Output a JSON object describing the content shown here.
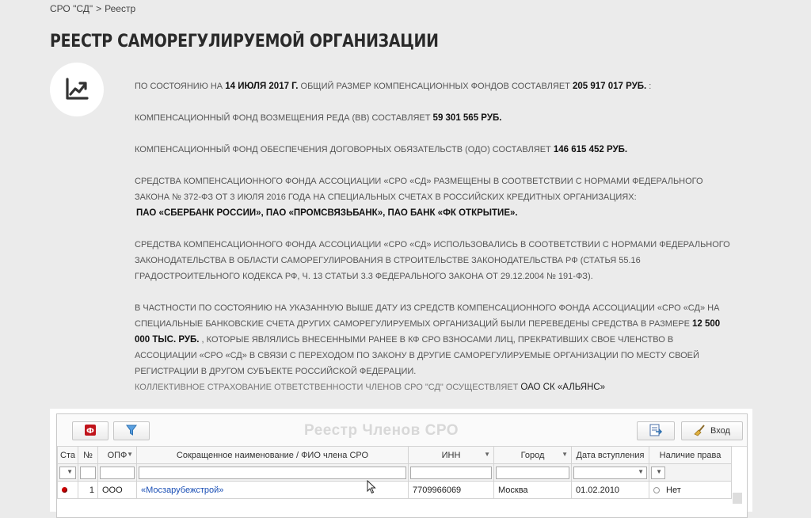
{
  "breadcrumb": {
    "home": "СРО \"СД\"",
    "separator": ">",
    "current": "Реестр"
  },
  "page_title": "РЕЕСТР САМОРЕГУЛИРУЕМОЙ ОРГАНИЗАЦИИ",
  "badge_icon": "chart-trend-up-icon",
  "info": {
    "p1_pre": "ПО СОСТОЯНИЮ НА ",
    "p1_date": "14 ИЮЛЯ 2017 Г.",
    "p1_mid": " ОБЩИЙ РАЗМЕР КОМПЕНСАЦИОННЫХ ФОНДОВ СОСТАВЛЯЕТ ",
    "p1_sum": "205 917 017 РУБ.",
    "p1_end": " :",
    "p2_pre": "КОМПЕНСАЦИОННЫЙ ФОНД ВОЗМЕЩЕНИЯ РЕДА (ВВ) СОСТАВЛЯЕТ ",
    "p2_sum": "59 301 565 РУБ.",
    "p3_pre": "КОМПЕНСАЦИОННЫЙ ФОНД ОБЕСПЕЧЕНИЯ ДОГОВОРНЫХ ОБЯЗАТЕЛЬСТВ (ОДО) СОСТАВЛЯЕТ ",
    "p3_sum": "146 615 452 РУБ.",
    "p4_l1": "СРЕДСТВА КОМПЕНСАЦИОННОГО ФОНДА АССОЦИАЦИИ «СРО «СД» РАЗМЕЩЕНЫ В СООТВЕТСТВИИ С НОРМАМИ ФЕДЕРАЛЬНОГО",
    "p4_l2": "ЗАКОНА № 372-ФЗ ОТ 3 ИЮЛЯ 2016 ГОДА НА СПЕЦИАЛЬНЫХ СЧЕТАХ В РОССИЙСКИХ КРЕДИТНЫХ ОРГАНИЗАЦИЯХ:",
    "p4_banks": "ПАО «СБЕРБАНК РОССИИ», ПАО «ПРОМСВЯЗЬБАНК», ПАО БАНК «ФК ОТКРЫТИЕ».",
    "p5_l1": "СРЕДСТВА КОМПЕНСАЦИОННОГО ФОНДА АССОЦИАЦИИ «СРО «СД» ИСПОЛЬЗОВАЛИСЬ В СООТВЕТСТВИИ С НОРМАМИ ФЕДЕРАЛЬНОГО",
    "p5_l2": "ЗАКОНОДАТЕЛЬСТВА В ОБЛАСТИ САМОРЕГУЛИРОВАНИЯ В СТРОИТЕЛЬСТВЕ ЗАКОНОДАТЕЛЬСТВА РФ (СТАТЬЯ 55.16",
    "p5_l3": "ГРАДОСТРОИТЕЛЬНОГО КОДЕКСА РФ, Ч. 13 СТАТЬИ 3.3 ФЕДЕРАЛЬНОГО ЗАКОНА ОТ 29.12.2004 № 191-ФЗ).",
    "p6_l1": "В ЧАСТНОСТИ ПО СОСТОЯНИЮ НА УКАЗАННУЮ ВЫШЕ ДАТУ ИЗ СРЕДСТВ КОМПЕНСАЦИОННОГО ФОНДА АССОЦИАЦИИ «СРО «СД» НА",
    "p6_l2_pre": "СПЕЦИАЛЬНЫЕ БАНКОВСКИЕ СЧЕТА ДРУГИХ САМОРЕГУЛИРУЕМЫХ ОРГАНИЗАЦИЙ БЫЛИ ПЕРЕВЕДЕНЫ СРЕДСТВА В РАЗМЕРЕ ",
    "p6_sum_a": "12 500",
    "p6_sum_b": "000 ТЫС. РУБ.",
    "p6_l3_post": " , КОТОРЫЕ ЯВЛЯЛИСЬ ВНЕСЕННЫМИ РАНЕЕ В КФ СРО ВЗНОСАМИ ЛИЦ, ПРЕКРАТИВШИХ СВОЕ ЧЛЕНСТВО В",
    "p6_l4": "АССОЦИАЦИИ «СРО «СД» В СВЯЗИ С ПЕРЕХОДОМ ПО ЗАКОНУ В ДРУГИЕ САМОРЕГУЛИРУЕМЫЕ ОРГАНИЗАЦИИ ПО МЕСТУ СВОЕЙ",
    "p6_l5": "РЕГИСТРАЦИИ В ДРУГОМ СУБЪЕКТЕ РОССИЙСКОЙ ФЕДЕРАЦИИ.",
    "p7_pre": "КОЛЛЕКТИВНОЕ СТРАХОВАНИЕ ОТВЕТСТВЕННОСТИ ЧЛЕНОВ СРО \"СД\" ОСУЩЕСТВЛЯЕТ ",
    "p7_insurer": "ОАО СК «АЛЬЯНС»"
  },
  "registry": {
    "title": "Реестр Членов СРО",
    "pdf_icon": "pdf-export-icon",
    "filter_icon": "funnel-filter-icon",
    "export_icon": "export-document-icon",
    "login_icon": "broom-login-icon",
    "login_label": "Вход",
    "columns": [
      "Ста",
      "№",
      "ОПФ",
      "Сокращенное наименование / ФИО члена СРО",
      "ИНН",
      "Город",
      "Дата вступления",
      "Наличие права"
    ],
    "rows": [
      {
        "status": "red",
        "num": "1",
        "opf": "ООО",
        "name": "«Мосзарубежстрой»",
        "inn": "7709966069",
        "city": "Москва",
        "date": "01.02.2010",
        "right": "Нет"
      }
    ]
  }
}
